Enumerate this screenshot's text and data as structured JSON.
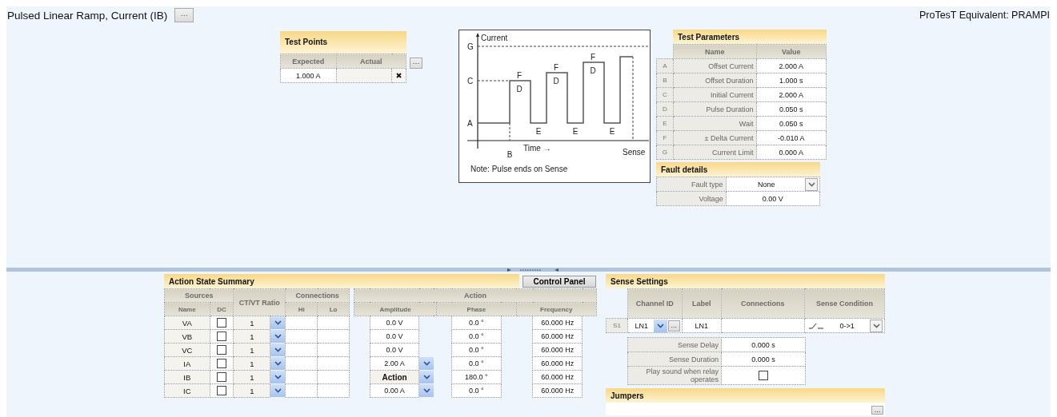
{
  "title": "Pulsed Linear Ramp, Current (IB)",
  "title_button": "···",
  "equivalent": "ProTesT Equivalent: PRAMPI",
  "test_points": {
    "title": "Test Points",
    "columns": [
      "Expected",
      "Actual"
    ],
    "rows": [
      {
        "expected": "1.000 A"
      }
    ],
    "more_button": "···"
  },
  "diagram": {
    "labels": [
      "Current",
      "G",
      "C",
      "A",
      "F",
      "D",
      "F",
      "D",
      "F",
      "D",
      "E",
      "E",
      "E",
      "Time →",
      "B",
      "Sense"
    ],
    "note": "Note: Pulse ends on Sense"
  },
  "test_parameters": {
    "title": "Test Parameters",
    "columns": [
      "Name",
      "Value"
    ],
    "rows": [
      {
        "key": "A",
        "name": "Offset Current",
        "value": "2.000 A"
      },
      {
        "key": "B",
        "name": "Offset Duration",
        "value": "1.000 s"
      },
      {
        "key": "C",
        "name": "Initial Current",
        "value": "2.000 A"
      },
      {
        "key": "D",
        "name": "Pulse Duration",
        "value": "0.050 s"
      },
      {
        "key": "E",
        "name": "Wait",
        "value": "0.050 s"
      },
      {
        "key": "F",
        "name": "± Delta Current",
        "value": "-0.010 A"
      },
      {
        "key": "G",
        "name": "Current Limit",
        "value": "0.000 A"
      }
    ]
  },
  "fault_details": {
    "title": "Fault details",
    "rows": [
      {
        "kind": "dropdown",
        "label": "Fault type",
        "value": "None"
      },
      {
        "kind": "text",
        "label": "Voltage",
        "value": "0.00 V"
      }
    ]
  },
  "action_state_summary": {
    "title": "Action State Summary",
    "control_panel_button": "Control Panel",
    "groups": [
      "Sources",
      "CT/VT Ratio",
      "Connections",
      "Action"
    ],
    "columns": [
      "Name",
      "DC",
      "Hi",
      "Lo",
      "Amplitude",
      "Phase",
      "Frequency"
    ],
    "rows": [
      {
        "name": "VA",
        "dc": false,
        "ratio": "1",
        "kind": "fixed",
        "amplitude": "0.0 V",
        "phase": "0.0 °",
        "frequency": "60.000 Hz"
      },
      {
        "name": "VB",
        "dc": false,
        "ratio": "1",
        "kind": "fixed",
        "amplitude": "0.0 V",
        "phase": "0.0 °",
        "frequency": "60.000 Hz"
      },
      {
        "name": "VC",
        "dc": false,
        "ratio": "1",
        "kind": "fixed",
        "amplitude": "0.0 V",
        "phase": "0.0 °",
        "frequency": "60.000 Hz"
      },
      {
        "name": "IA",
        "dc": false,
        "ratio": "1",
        "kind": "adjustable",
        "amplitude": "2.00 A",
        "phase": "0.0 °",
        "frequency": "60.000 Hz"
      },
      {
        "name": "IB",
        "dc": false,
        "ratio": "1",
        "kind": "action",
        "amplitude": "Action",
        "phase": "180.0 °",
        "frequency": "60.000 Hz"
      },
      {
        "name": "IC",
        "dc": false,
        "ratio": "1",
        "kind": "adjustable",
        "amplitude": "0.00 A",
        "phase": "0.0 °",
        "frequency": "60.000 Hz"
      }
    ]
  },
  "sense_settings": {
    "title": "Sense Settings",
    "columns": [
      "Channel ID",
      "Label",
      "Connections",
      "Sense Condition"
    ],
    "row": {
      "id": "S1",
      "channel": "LN1",
      "more_button": "...",
      "label": "LN1",
      "condition": "0->1"
    },
    "options": [
      {
        "kind": "text",
        "label": "Sense Delay",
        "value": "0.000 s"
      },
      {
        "kind": "text",
        "label": "Sense Duration",
        "value": "0.000 s"
      },
      {
        "kind": "checkbox",
        "label": "Play sound when relay operates",
        "checked": false
      }
    ]
  },
  "jumpers": {
    "title": "Jumpers",
    "more_button": "..."
  }
}
